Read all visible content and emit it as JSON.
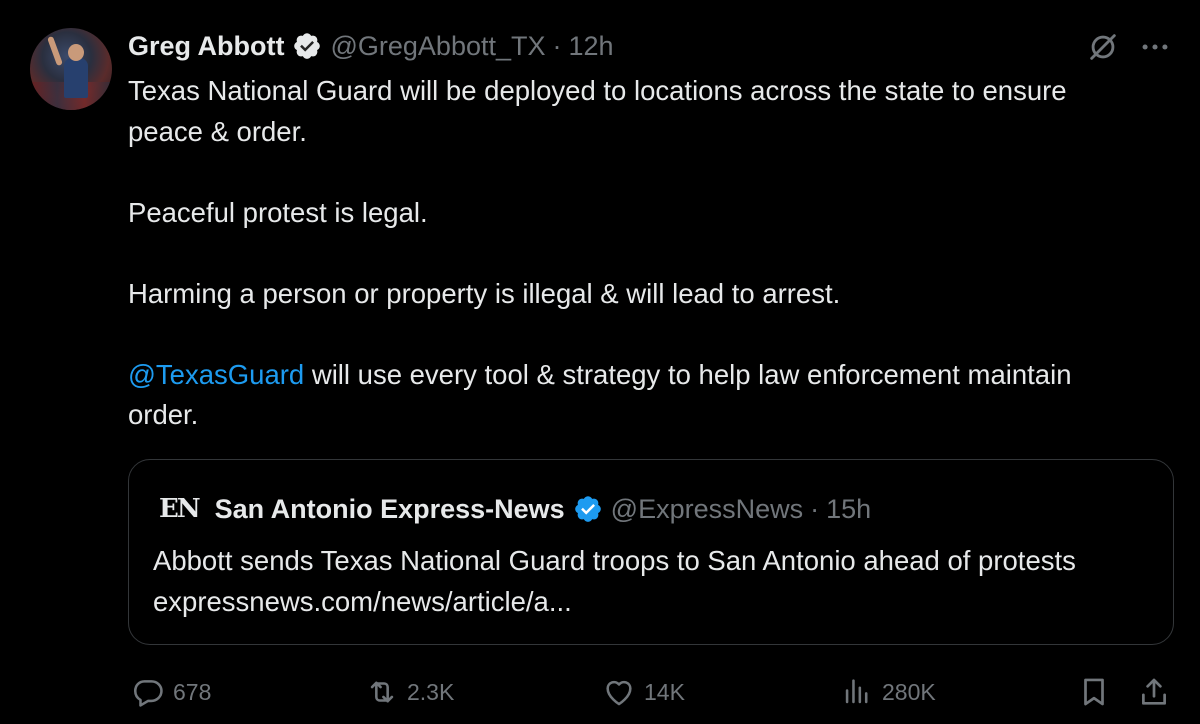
{
  "author": {
    "name": "Greg Abbott",
    "handle": "@GregAbbott_TX",
    "separator": "·",
    "time": "12h"
  },
  "body": {
    "line1": "Texas National Guard will be deployed to locations across the state to ensure peace & order.",
    "line2": "Peaceful protest is legal.",
    "line3": "Harming a person or property is illegal & will lead to arrest.",
    "mention": "@TexasGuard",
    "line4_rest": " will use every tool & strategy to help law enforcement maintain order."
  },
  "quote": {
    "logo": "EN",
    "name": "San Antonio Express-News",
    "handle": "@ExpressNews",
    "separator": "·",
    "time": "15h",
    "text": "Abbott sends Texas National Guard troops to San Antonio ahead of protests expressnews.com/news/article/a..."
  },
  "actions": {
    "replies": "678",
    "reposts": "2.3K",
    "likes": "14K",
    "views": "280K"
  },
  "icons": {
    "verified": "verified-badge-icon",
    "grok": "grok-icon",
    "more": "more-icon",
    "reply": "reply-icon",
    "repost": "repost-icon",
    "like": "like-icon",
    "views": "views-icon",
    "bookmark": "bookmark-icon",
    "share": "share-icon"
  },
  "colors": {
    "background": "#000000",
    "text": "#e7e9ea",
    "secondary": "#71767b",
    "accent": "#1d9bf0",
    "border": "#333639"
  }
}
